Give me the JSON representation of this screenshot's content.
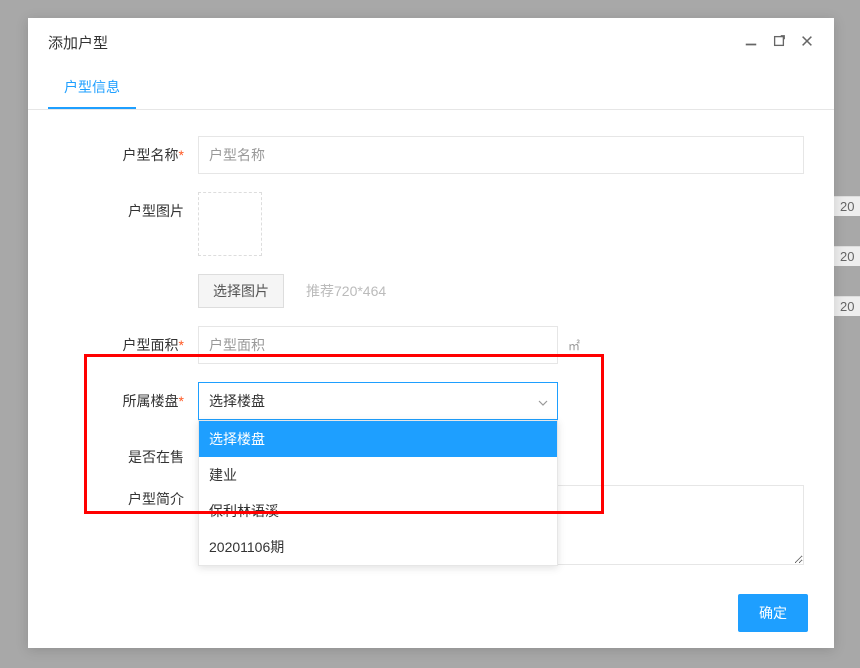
{
  "modal": {
    "title": "添加户型",
    "tab_label": "户型信息"
  },
  "form": {
    "name_label": "户型名称",
    "name_placeholder": "户型名称",
    "image_label": "户型图片",
    "select_image_btn": "选择图片",
    "image_hint": "推荐720*464",
    "area_label": "户型面积",
    "area_placeholder": "户型面积",
    "area_unit": "㎡",
    "building_label": "所属楼盘",
    "building_selected": "选择楼盘",
    "building_options": [
      "选择楼盘",
      "建业",
      "保利林语溪",
      "20201106期"
    ],
    "onsale_label": "是否在售",
    "intro_label": "户型简介"
  },
  "actions": {
    "confirm": "确定"
  },
  "bg": {
    "row1": "20",
    "row2": "20",
    "row3": "20"
  }
}
